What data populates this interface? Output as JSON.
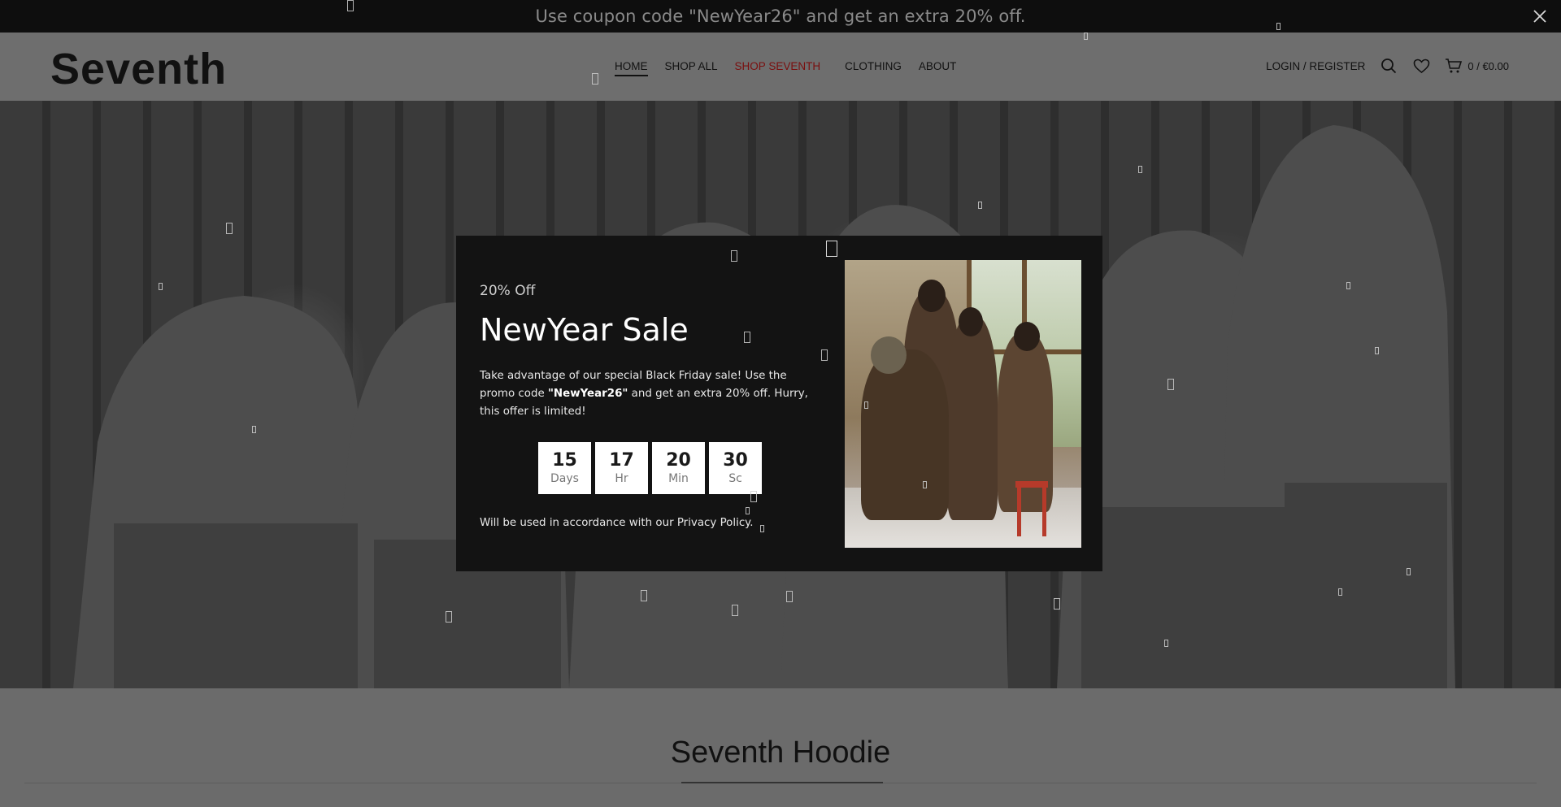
{
  "announcement": {
    "text": "Use coupon code \"NewYear26\" and get an extra 20% off.",
    "close_icon": "close-icon"
  },
  "header": {
    "logo": "Seventh",
    "nav": [
      "HOME",
      "SHOP ALL",
      "SHOP SEVENTH",
      "CLOTHING",
      "ABOUT"
    ],
    "active_nav": "HOME",
    "accent_nav": "SHOP SEVENTH",
    "accent_color": "#7a0f0f",
    "login_label": "LOGIN / REGISTER",
    "icons": [
      "search-icon",
      "wishlist-heart-icon",
      "cart-icon"
    ],
    "cart_label": "0 / €0.00"
  },
  "popup": {
    "subtitle": "20% Off",
    "title": "NewYear Sale",
    "desc_before": "Take advantage of our special Black Friday sale! Use the promo code ",
    "promo_code": "\"NewYear26\"",
    "desc_after": " and get an extra 20% off. Hurry, this offer is limited!",
    "countdown": [
      {
        "value": "15",
        "label": "Days"
      },
      {
        "value": "17",
        "label": "Hr"
      },
      {
        "value": "20",
        "label": "Min"
      },
      {
        "value": "30",
        "label": "Sc"
      }
    ],
    "privacy_prefix": "Will be used in accordance with our ",
    "privacy_link": "Privacy Policy."
  },
  "section": {
    "title": "Seventh Hoodie"
  }
}
